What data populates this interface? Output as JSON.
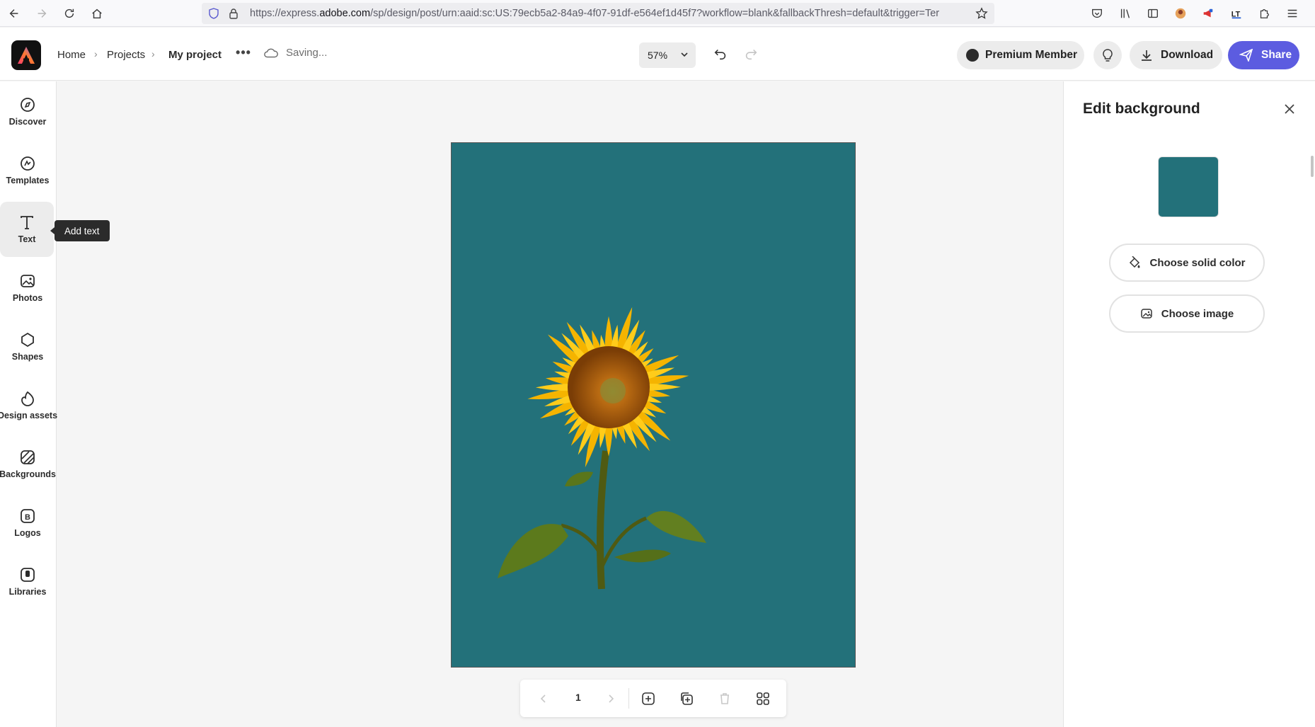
{
  "browser": {
    "url_prefix": "https://express.",
    "url_domain": "adobe.com",
    "url_rest": "/sp/design/post/urn:aaid:sc:US:79ecb5a2-84a9-4f07-91df-e564ef1d45f7?workflow=blank&fallbackThresh=default&trigger=Ter"
  },
  "header": {
    "breadcrumb": [
      "Home",
      "Projects",
      "My project"
    ],
    "save_status": "Saving...",
    "zoom": "57%",
    "premium_label": "Premium Member",
    "download_label": "Download",
    "share_label": "Share"
  },
  "sidebar": {
    "items": [
      {
        "label": "Discover",
        "icon": "compass-icon"
      },
      {
        "label": "Templates",
        "icon": "templates-icon"
      },
      {
        "label": "Text",
        "icon": "text-icon",
        "active": true
      },
      {
        "label": "Photos",
        "icon": "photo-icon"
      },
      {
        "label": "Shapes",
        "icon": "shapes-icon"
      },
      {
        "label": "Design assets",
        "icon": "design-assets-icon"
      },
      {
        "label": "Backgrounds",
        "icon": "backgrounds-icon"
      },
      {
        "label": "Logos",
        "icon": "logos-icon"
      },
      {
        "label": "Libraries",
        "icon": "libraries-icon"
      }
    ],
    "tooltip": "Add text"
  },
  "canvas": {
    "background_color": "#23717a",
    "page_number": "1"
  },
  "panel": {
    "title": "Edit background",
    "swatch_color": "#23717a",
    "solid_color_label": "Choose solid color",
    "image_label": "Choose image"
  },
  "colors": {
    "accent": "#5c5ce0",
    "teal": "#23717a"
  }
}
